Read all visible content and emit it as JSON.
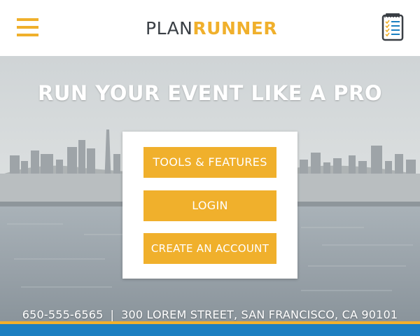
{
  "header": {
    "logo_plan": "PLAN",
    "logo_runner": "RUNNER",
    "menu_icon": "hamburger-menu-icon",
    "checklist_icon": "checklist-icon"
  },
  "hero": {
    "headline": "RUN YOUR EVENT LIKE A PRO",
    "background": "san-francisco-skyline-photo"
  },
  "actions": {
    "tools_label": "TOOLS & FEATURES",
    "login_label": "LOGIN",
    "create_account_label": "CREATE AN ACCOUNT"
  },
  "contact": {
    "phone": "650-555-6565",
    "separator": "|",
    "address": "300 LOREM STREET, SAN FRANCISCO, CA 90101"
  },
  "colors": {
    "accent": "#f0b02c",
    "logo_dark": "#3a3f45",
    "footer_blue": "#1b7fc1"
  }
}
